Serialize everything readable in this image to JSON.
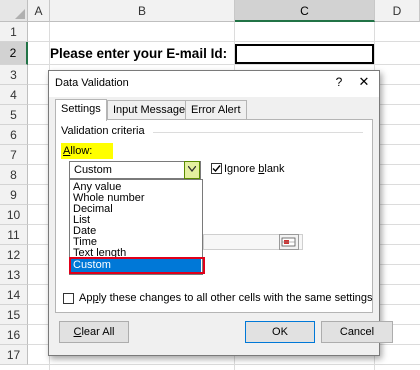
{
  "sheet": {
    "columns": [
      "A",
      "B",
      "C",
      "D"
    ],
    "rows": [
      "1",
      "2",
      "3",
      "4",
      "5",
      "6",
      "7",
      "8",
      "9",
      "10",
      "11",
      "12",
      "13",
      "14",
      "15",
      "16",
      "17"
    ],
    "prompt": "Please enter your E-mail Id:"
  },
  "dialog": {
    "title": "Data Validation",
    "help": "?",
    "close": "✕",
    "tabs": [
      "Settings",
      "Input Message",
      "Error Alert"
    ],
    "validation_criteria": "Validation criteria",
    "allow": {
      "prefix": "",
      "accel": "A",
      "rest": "llow:"
    },
    "allow_value": "Custom",
    "ignore_blank": {
      "text": "Ignore ",
      "accel": "b",
      "rest": "lank",
      "checked": true
    },
    "dropdown": [
      "Any value",
      "Whole number",
      "Decimal",
      "List",
      "Date",
      "Time",
      "Text length",
      "Custom"
    ],
    "selected_option": "Custom",
    "apply": {
      "text": "Ap",
      "accel": "p",
      "rest": "ly these changes to all other cells with the same settings",
      "checked": false
    },
    "buttons": {
      "clear": {
        "accel": "C",
        "rest": "lear All"
      },
      "ok": "OK",
      "cancel": "Cancel"
    }
  },
  "colors": {
    "highlight_yellow": "#ffff00",
    "selection_blue": "#0078d7",
    "outline_red": "#e0001a",
    "excel_green": "#217346"
  }
}
